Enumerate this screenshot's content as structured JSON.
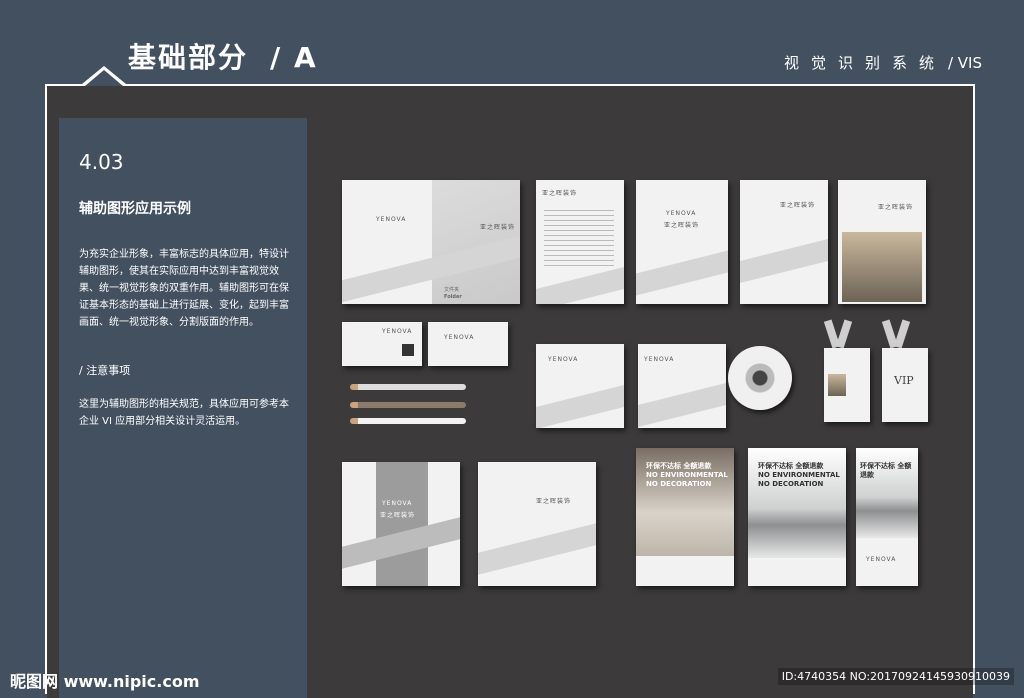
{
  "header": {
    "title": "基础部分",
    "code": "/ A",
    "subtitle": "视觉识别系统",
    "subtitle_tag": "/ VIS"
  },
  "sidebar": {
    "section_number": "4.03",
    "section_title": "辅助图形应用示例",
    "paragraph1": "为充实企业形象，丰富标志的具体应用，特设计辅助图形，使其在实际应用中达到丰富视觉效果、统一视觉形象的双重作用。辅助图形可在保证基本形态的基础上进行延展、变化，起到丰富画面、统一视觉形象、分割版面的作用。",
    "notes_title": "/ 注意事项",
    "paragraph2": "这里为辅助图形的相关规范，具体应用可参考本企业 VI 应用部分相关设计灵活运用。"
  },
  "mockups": {
    "brand": "YENOVA",
    "brand_cn": "亚之晖装饰",
    "folder_cn": "文件夹",
    "folder_en": "Folder",
    "poster_slogan": "环保不达标 全额退款",
    "poster_en1": "NO ENVIRONMENTAL",
    "poster_en2": "NO DECORATION",
    "badge_vip": "VIP"
  },
  "footer": {
    "watermark": "昵图网 www.nipic.com",
    "id_line": "ID:4740354 NO:20170924145930910039"
  },
  "colors": {
    "frame_bg": "#435060",
    "panel_bg": "#3c3a3a",
    "accent": "#ffffff"
  }
}
